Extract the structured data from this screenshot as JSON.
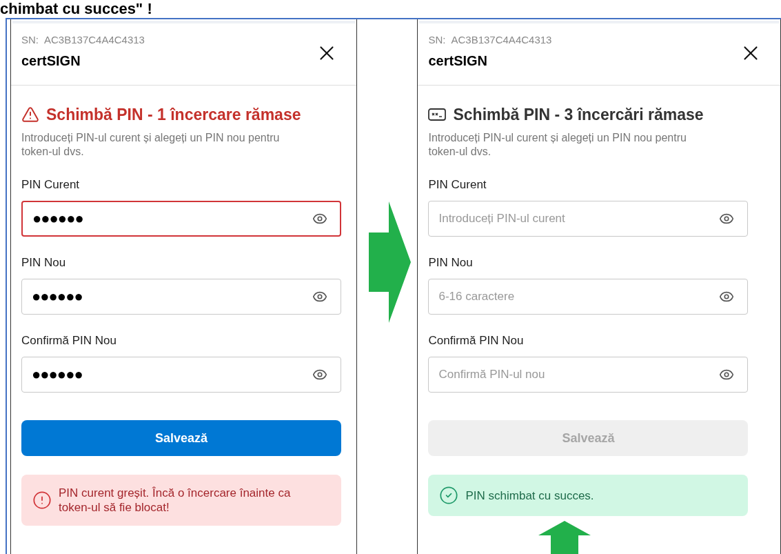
{
  "heading": "chimbat cu succes\" !",
  "panels": [
    {
      "serial_label": "SN:",
      "serial": "AC3B137C4A4C4313",
      "brand": "certSIGN",
      "title": {
        "text": "Schimbă PIN - 1 încercare rămase",
        "kind": "error"
      },
      "description": "Introduceți PIN-ul curent și alegeți un PIN nou pentru token-ul dvs.",
      "fields": [
        {
          "label": "PIN Curent",
          "value": "●●●●●●",
          "error": true
        },
        {
          "label": "PIN Nou",
          "value": "●●●●●●",
          "error": false
        },
        {
          "label": "Confirmă PIN Nou",
          "value": "●●●●●●",
          "error": false
        }
      ],
      "save_button": {
        "label": "Salvează",
        "disabled": false
      },
      "alert": {
        "kind": "error",
        "text": "PIN curent greșit. Încă o încercare înainte ca token-ul să fie blocat!"
      }
    },
    {
      "serial_label": "SN:",
      "serial": "AC3B137C4A4C4313",
      "brand": "certSIGN",
      "title": {
        "text": "Schimbă PIN - 3 încercări rămase",
        "kind": "info"
      },
      "description": "Introduceți PIN-ul curent și alegeți un PIN nou pentru token-ul dvs.",
      "fields": [
        {
          "label": "PIN Curent",
          "placeholder": "Introduceți PIN-ul curent",
          "error": false
        },
        {
          "label": "PIN Nou",
          "placeholder": "6-16 caractere",
          "error": false
        },
        {
          "label": "Confirmă PIN Nou",
          "placeholder": "Confirmă PIN-ul nou",
          "error": false
        }
      ],
      "save_button": {
        "label": "Salvează",
        "disabled": true
      },
      "alert": {
        "kind": "success",
        "text": "PIN schimbat cu succes."
      }
    }
  ]
}
